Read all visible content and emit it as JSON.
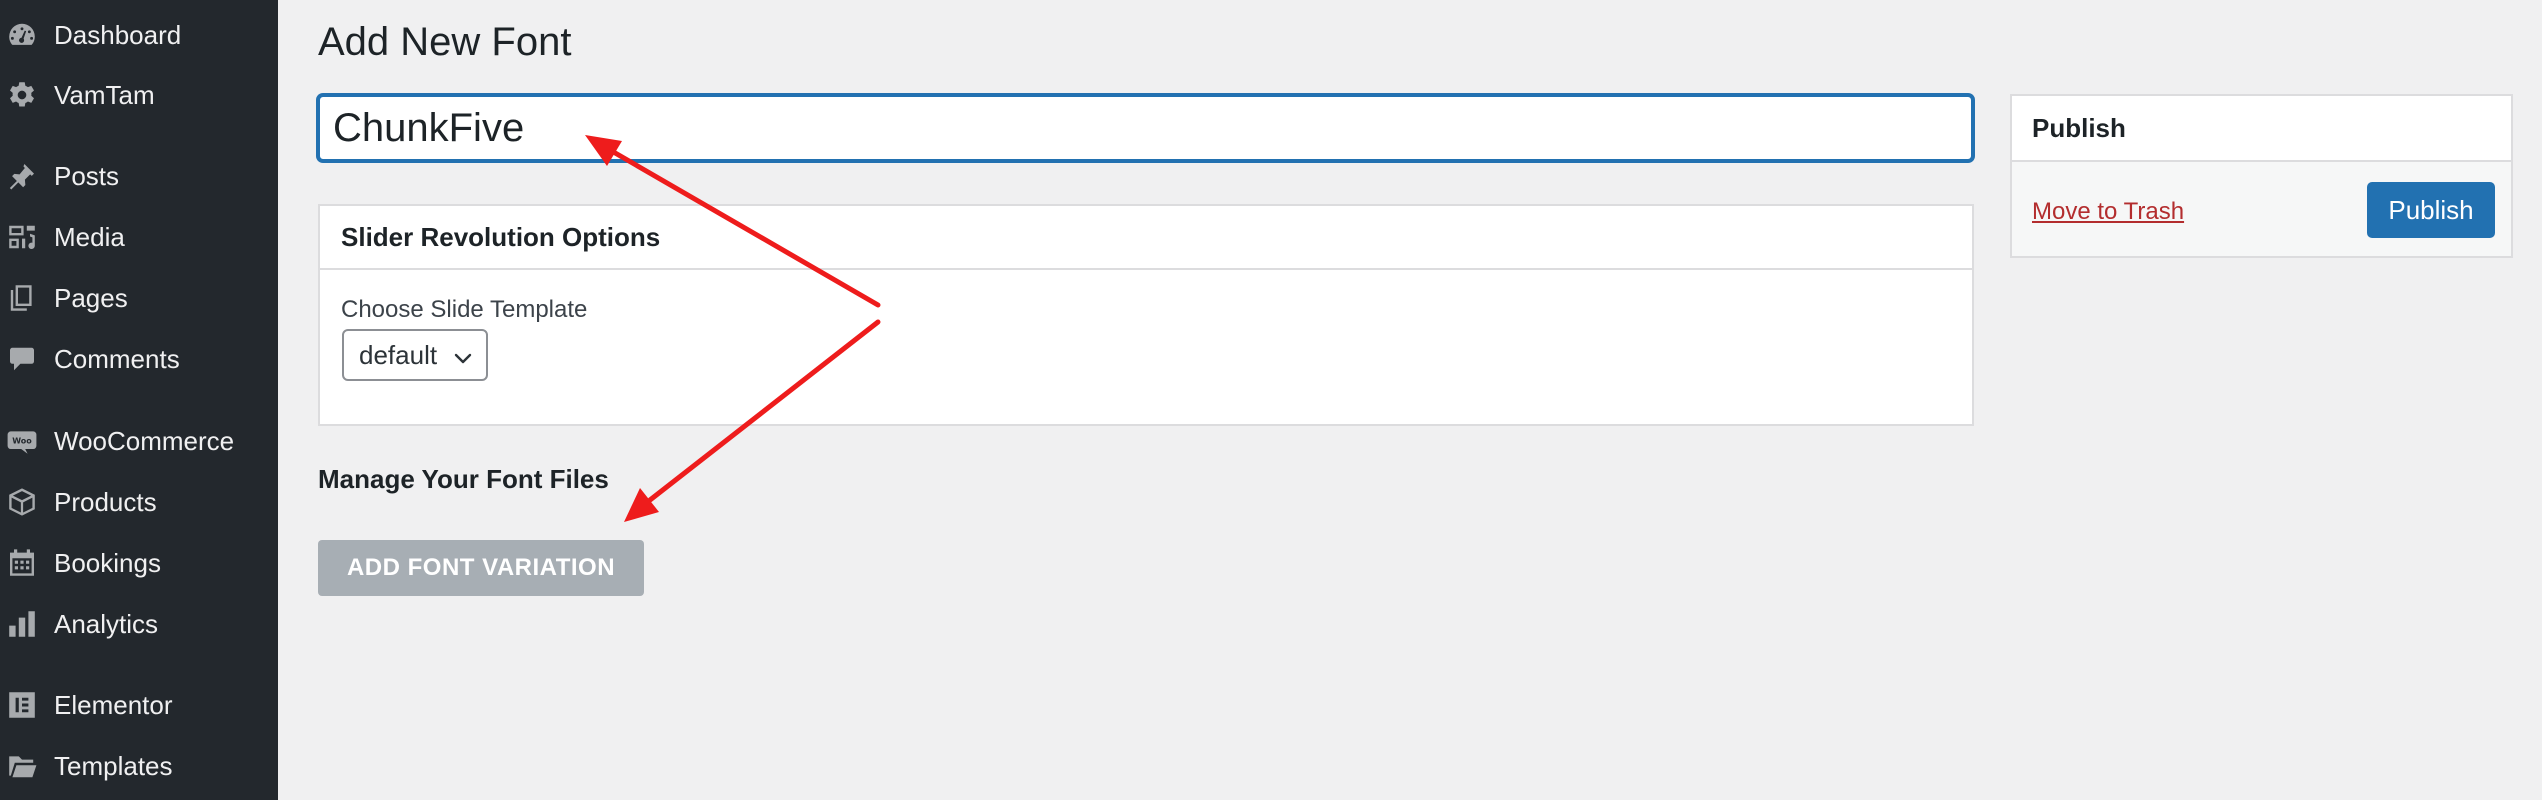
{
  "sidebar": {
    "items": [
      {
        "label": "Dashboard",
        "icon": "dashboard-icon"
      },
      {
        "label": "VamTam",
        "icon": "gear-icon"
      },
      {
        "label": "Posts",
        "icon": "pin-icon"
      },
      {
        "label": "Media",
        "icon": "media-icon"
      },
      {
        "label": "Pages",
        "icon": "pages-icon"
      },
      {
        "label": "Comments",
        "icon": "comment-icon"
      },
      {
        "label": "WooCommerce",
        "icon": "woocommerce-icon"
      },
      {
        "label": "Products",
        "icon": "box-icon"
      },
      {
        "label": "Bookings",
        "icon": "calendar-icon"
      },
      {
        "label": "Analytics",
        "icon": "bar-chart-icon"
      },
      {
        "label": "Elementor",
        "icon": "elementor-icon"
      },
      {
        "label": "Templates",
        "icon": "folder-icon"
      }
    ]
  },
  "main": {
    "page_title": "Add New Font",
    "title_input_value": "ChunkFive",
    "slider_box": {
      "title": "Slider Revolution Options",
      "template_label": "Choose Slide Template",
      "template_selected": "default"
    },
    "manage_heading": "Manage Your Font Files",
    "add_variation_label": "ADD FONT VARIATION"
  },
  "publish": {
    "title": "Publish",
    "trash_label": "Move to Trash",
    "publish_label": "Publish"
  },
  "colors": {
    "sidebar_bg": "#23282d",
    "accent": "#2271b1",
    "trash_link": "#b32d2e",
    "disabled_button": "#a7aeb4",
    "annotation_arrow": "#ee1c1c"
  }
}
